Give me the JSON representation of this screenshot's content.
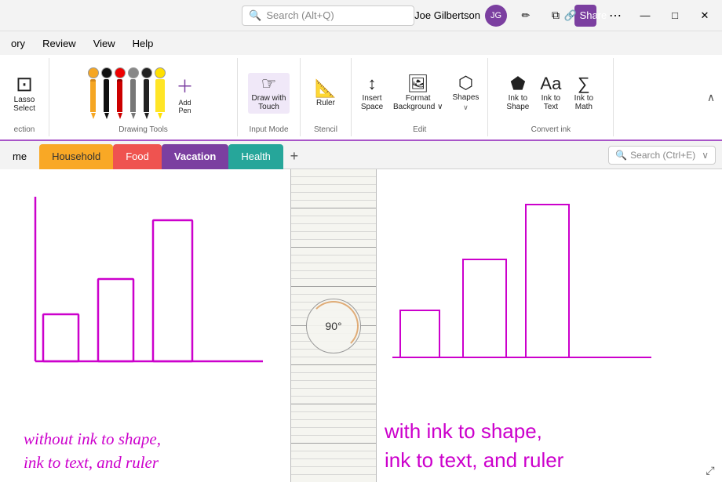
{
  "titlebar": {
    "search_placeholder": "Search (Alt+Q)",
    "user_name": "Joe Gilbertson",
    "avatar_initials": "JG",
    "pen_icon": "✏",
    "minimize": "—",
    "maximize": "□",
    "close": "✕"
  },
  "menubar": {
    "items": [
      "ory",
      "Review",
      "View",
      "Help"
    ]
  },
  "ribbon": {
    "section_drawing_tools": "Drawing Tools",
    "section_input_mode": "Input Mode",
    "section_stencil": "Stencil",
    "section_edit": "Edit",
    "section_convert": "Convert ink",
    "lasso_label": "Lasso\nSelect",
    "pens": [
      {
        "color": "#f5a623",
        "shaft": "#f5a623"
      },
      {
        "color": "#111",
        "shaft": "#111"
      },
      {
        "color": "#e00",
        "shaft": "#e00"
      },
      {
        "color": "#888",
        "shaft": "#888"
      },
      {
        "color": "#222",
        "shaft": "#222"
      },
      {
        "color": "#ffe000",
        "shaft": "#ffe000"
      }
    ],
    "add_pen_label": "Add\nPen",
    "draw_touch_label": "Draw with\nTouch",
    "ruler_label": "Ruler",
    "insert_space_label": "Insert\nSpace",
    "format_bg_label": "Format\nBackground",
    "shapes_label": "Shapes",
    "ink_to_shape_label": "Ink to\nShape",
    "ink_to_text_label": "Ink to\nText",
    "ink_to_math_label": "Ink to\nMath",
    "select_label": "Select",
    "section_selection": "ection"
  },
  "tabs": {
    "home_label": "me",
    "household_label": "Household",
    "food_label": "Food",
    "vacation_label": "Vacation",
    "health_label": "Health",
    "add_tooltip": "+",
    "search_placeholder": "Search (Ctrl+E)"
  },
  "canvas": {
    "left_annotation_line1": "without ink to shape,",
    "left_annotation_line2": "ink to text, and ruler",
    "right_annotation_line1": "with ink to shape,",
    "right_annotation_line2": "ink to text, and ruler",
    "ruler_angle": "90°"
  }
}
